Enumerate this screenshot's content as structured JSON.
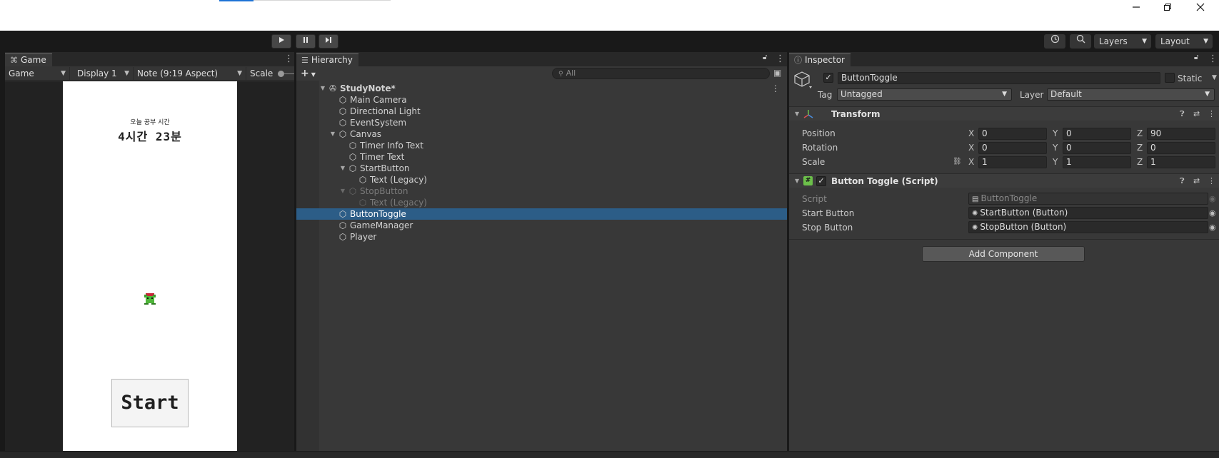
{
  "window": {
    "minimize_icon": "minimize-icon",
    "restore_icon": "restore-icon",
    "close_icon": "close-icon"
  },
  "toolbar": {
    "play_icon": "play-icon",
    "pause_icon": "pause-icon",
    "step_icon": "step-icon",
    "history_icon": "history-icon",
    "search_icon": "search-icon",
    "layers_label": "Layers",
    "layout_label": "Layout"
  },
  "game": {
    "tab_label": "Game",
    "mode_label": "Game",
    "display_label": "Display 1",
    "aspect_label": "Note (9:19 Aspect)",
    "scale_label": "Scale",
    "study_label": "오늘 공부 시간",
    "study_time": "4시간 23분",
    "start_button": "Start"
  },
  "hierarchy": {
    "tab_label": "Hierarchy",
    "search_placeholder": "All",
    "add_label": "+",
    "items": [
      {
        "label": "StudyNote*",
        "depth": 0,
        "expanded": true,
        "scene": true
      },
      {
        "label": "Main Camera",
        "depth": 1
      },
      {
        "label": "Directional Light",
        "depth": 1
      },
      {
        "label": "EventSystem",
        "depth": 1
      },
      {
        "label": "Canvas",
        "depth": 1,
        "expanded": true
      },
      {
        "label": "Timer Info Text",
        "depth": 2
      },
      {
        "label": "Timer Text",
        "depth": 2
      },
      {
        "label": "StartButton",
        "depth": 2,
        "expanded": true
      },
      {
        "label": "Text (Legacy)",
        "depth": 3
      },
      {
        "label": "StopButton",
        "depth": 2,
        "expanded": true,
        "inactive": true
      },
      {
        "label": "Text (Legacy)",
        "depth": 3,
        "inactive": true
      },
      {
        "label": "ButtonToggle",
        "depth": 1,
        "selected": true
      },
      {
        "label": "GameManager",
        "depth": 1
      },
      {
        "label": "Player",
        "depth": 1
      }
    ]
  },
  "inspector": {
    "tab_label": "Inspector",
    "object_name": "ButtonToggle",
    "static_label": "Static",
    "tag_label": "Tag",
    "tag_value": "Untagged",
    "layer_label": "Layer",
    "layer_value": "Default",
    "transform": {
      "title": "Transform",
      "position_label": "Position",
      "rotation_label": "Rotation",
      "scale_label": "Scale",
      "position": {
        "x": "0",
        "y": "0",
        "z": "90"
      },
      "rotation": {
        "x": "0",
        "y": "0",
        "z": "0"
      },
      "scale": {
        "x": "1",
        "y": "1",
        "z": "1"
      }
    },
    "script_component": {
      "title": "Button Toggle (Script)",
      "script_label": "Script",
      "script_value": "ButtonToggle",
      "start_label": "Start Button",
      "start_value": "StartButton (Button)",
      "stop_label": "Stop Button",
      "stop_value": "StopButton (Button)"
    },
    "add_component": "Add Component"
  }
}
